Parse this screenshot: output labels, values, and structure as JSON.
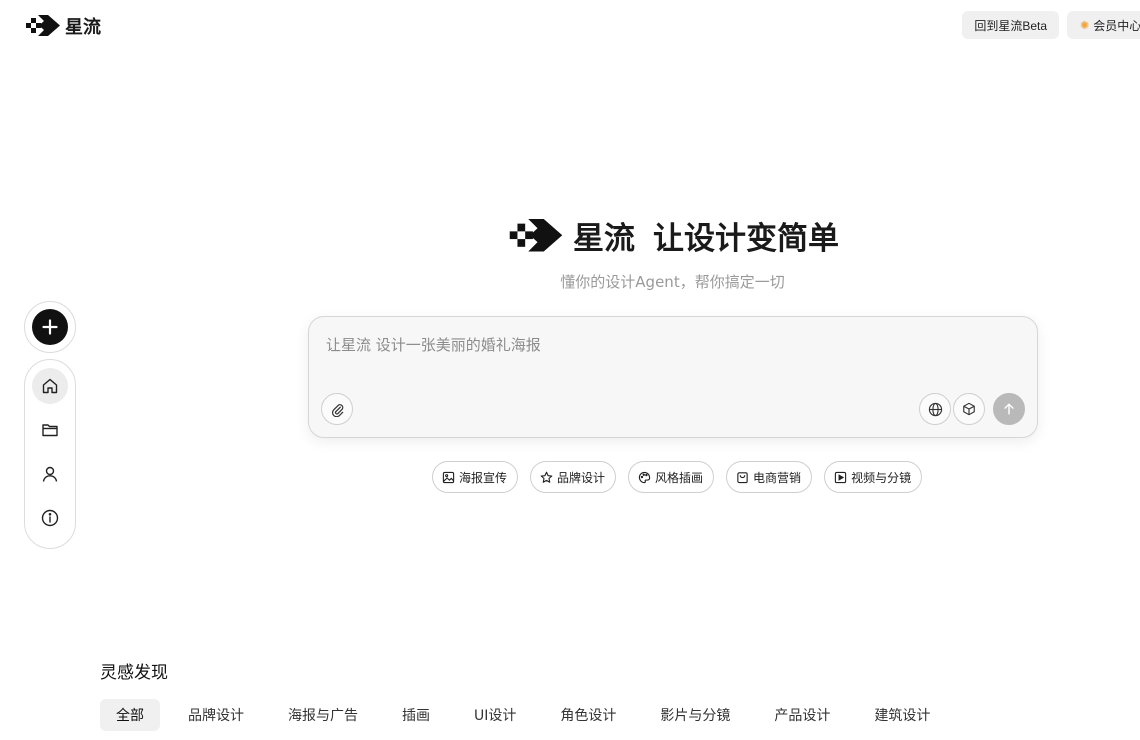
{
  "header": {
    "brand": "星流",
    "back_beta_label": "回到星流Beta",
    "member_label": "会员中心"
  },
  "hero": {
    "brand": "星流",
    "slogan": "让设计变简单",
    "subtitle": "懂你的设计Agent，帮你搞定一切"
  },
  "prompt": {
    "placeholder": "让星流 设计一张美丽的婚礼海报",
    "value": ""
  },
  "chips": [
    {
      "label": "海报宣传",
      "icon": "image-icon"
    },
    {
      "label": "品牌设计",
      "icon": "star-icon"
    },
    {
      "label": "风格插画",
      "icon": "palette-icon"
    },
    {
      "label": "电商营销",
      "icon": "shopping-bag-icon"
    },
    {
      "label": "视频与分镜",
      "icon": "play-icon"
    }
  ],
  "rail": {
    "items": [
      {
        "name": "home",
        "icon": "home-icon",
        "active": true
      },
      {
        "name": "folder",
        "icon": "folder-icon"
      },
      {
        "name": "profile",
        "icon": "user-icon"
      },
      {
        "name": "info",
        "icon": "info-icon"
      }
    ]
  },
  "inspiration": {
    "title": "灵感发现",
    "tabs": [
      "全部",
      "品牌设计",
      "海报与广告",
      "插画",
      "UI设计",
      "角色设计",
      "影片与分镜",
      "产品设计",
      "建筑设计"
    ],
    "active_tab": "全部"
  }
}
